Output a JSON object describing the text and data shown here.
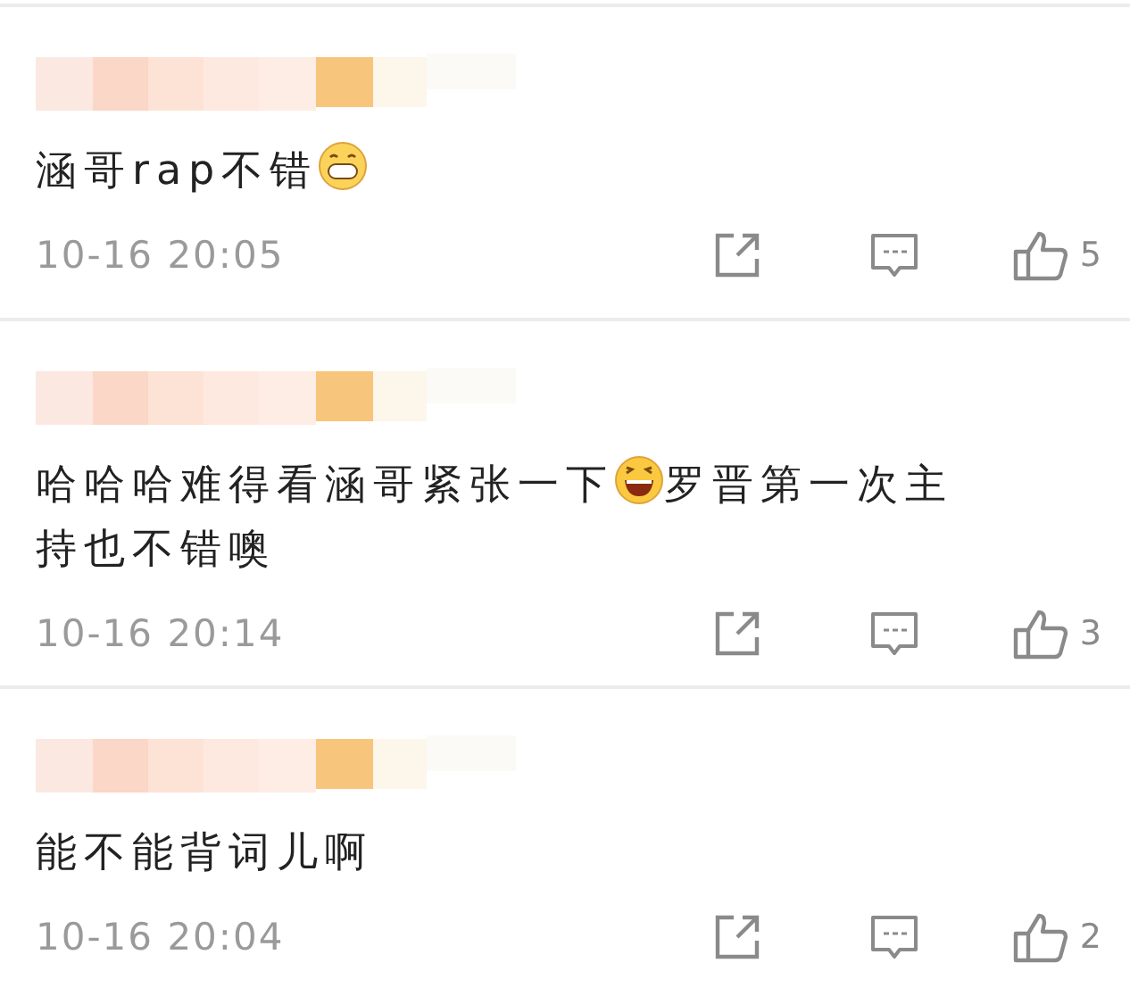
{
  "comments": [
    {
      "parts": [
        {
          "kind": "text",
          "text": "涵哥rap不错"
        },
        {
          "kind": "grin"
        }
      ],
      "time": "10-16 20:05",
      "likes": "5"
    },
    {
      "parts": [
        {
          "kind": "text",
          "text": "哈哈哈难得看涵哥紧张一下"
        },
        {
          "kind": "laugh"
        },
        {
          "kind": "text",
          "text": "罗晋第一次主"
        },
        {
          "kind": "text",
          "text": "持也不错噢"
        }
      ],
      "time": "10-16 20:14",
      "likes": "3"
    },
    {
      "parts": [
        {
          "kind": "text",
          "text": "能不能背词儿啊"
        }
      ],
      "time": "10-16 20:04",
      "likes": "2"
    }
  ]
}
